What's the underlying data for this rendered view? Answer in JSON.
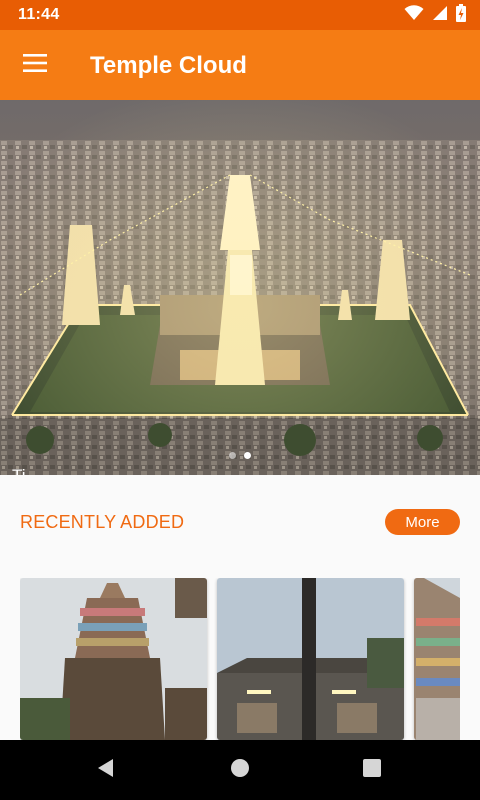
{
  "status_bar": {
    "time": "11:44",
    "icons": [
      "wifi-icon",
      "signal-icon",
      "battery-charging-icon"
    ]
  },
  "app_bar": {
    "title": "Temple Cloud",
    "menu_icon": "hamburger-menu-icon"
  },
  "hero_carousel": {
    "caption": "Ti",
    "image": "aerial-temple-complex-night-lights",
    "slide_count": 2,
    "active_slide": 2
  },
  "recently_added": {
    "title": "RECENTLY ADDED",
    "more_label": "More",
    "items": [
      {
        "image": "temple-gopuram-tower-photo"
      },
      {
        "image": "temple-flagpole-entrance-photo"
      },
      {
        "image": "colorful-gopuram-photo"
      }
    ]
  },
  "nav_bar": {
    "icons": [
      "back-icon",
      "home-icon",
      "recents-icon"
    ]
  },
  "colors": {
    "status_bar": "#e85d04",
    "app_bar": "#f57c14",
    "accent": "#f06a12"
  }
}
